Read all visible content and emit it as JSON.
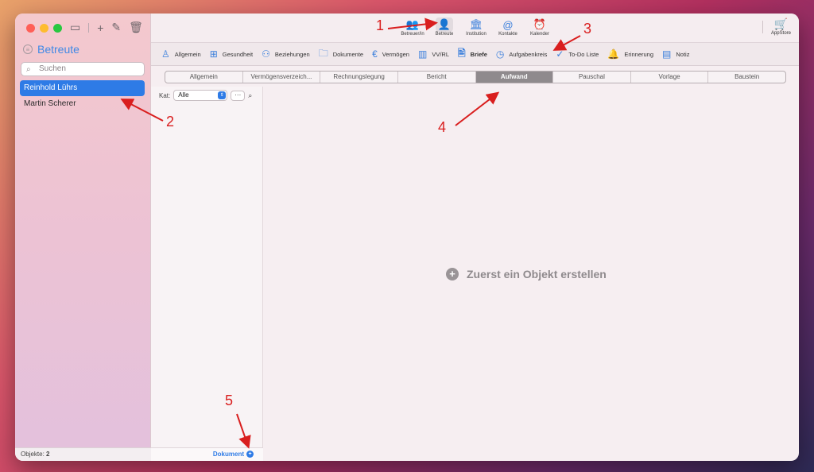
{
  "sidebar": {
    "title": "Betreute",
    "search_placeholder": "Suchen",
    "items": [
      {
        "label": "Reinhold Lührs",
        "selected": true
      },
      {
        "label": "Martin Scherer",
        "selected": false
      }
    ],
    "footer_label": "Objekte:",
    "footer_count": "2"
  },
  "toolbar": {
    "items": [
      {
        "label": "Betreuer/in",
        "icon": "users-icon"
      },
      {
        "label": "Betreute",
        "icon": "person-icon",
        "active": true
      },
      {
        "label": "Institution",
        "icon": "building-icon"
      },
      {
        "label": "Kontakte",
        "icon": "at-icon"
      },
      {
        "label": "Kalender",
        "icon": "alarm-clock-icon"
      }
    ],
    "appstore_label": "AppStore"
  },
  "subtoolbar": {
    "items": [
      {
        "label": "Allgemein",
        "icon": "person-outline-icon"
      },
      {
        "label": "Gesundheit",
        "icon": "medical-kit-icon"
      },
      {
        "label": "Beziehungen",
        "icon": "relations-icon"
      },
      {
        "label": "Dokumente",
        "icon": "folder-icon"
      },
      {
        "label": "Vermögen",
        "icon": "euro-icon"
      },
      {
        "label": "VV/RL",
        "icon": "books-icon"
      },
      {
        "label": "Briefe",
        "icon": "letter-icon",
        "active": true
      },
      {
        "label": "Aufgabenkreis",
        "icon": "clock-icon"
      },
      {
        "label": "To-Do Liste",
        "icon": "checkmark-icon"
      },
      {
        "label": "Erinnerung",
        "icon": "bell-icon"
      },
      {
        "label": "Notiz",
        "icon": "note-icon"
      }
    ]
  },
  "segments": [
    "Allgemein",
    "Vermögensverzeich...",
    "Rechnungslegung",
    "Bericht",
    "Aufwand",
    "Pauschal",
    "Vorlage",
    "Baustein"
  ],
  "segment_selected": "Aufwand",
  "listpane": {
    "kat_label": "Kat:",
    "kat_value": "Alle",
    "more_label": "···",
    "footer_label": "Dokument"
  },
  "empty_state": "Zuerst ein Objekt erstellen",
  "annotations": [
    "1",
    "2",
    "3",
    "4",
    "5"
  ],
  "colors": {
    "accent": "#2e7be6",
    "annotation": "#d91e1e"
  }
}
